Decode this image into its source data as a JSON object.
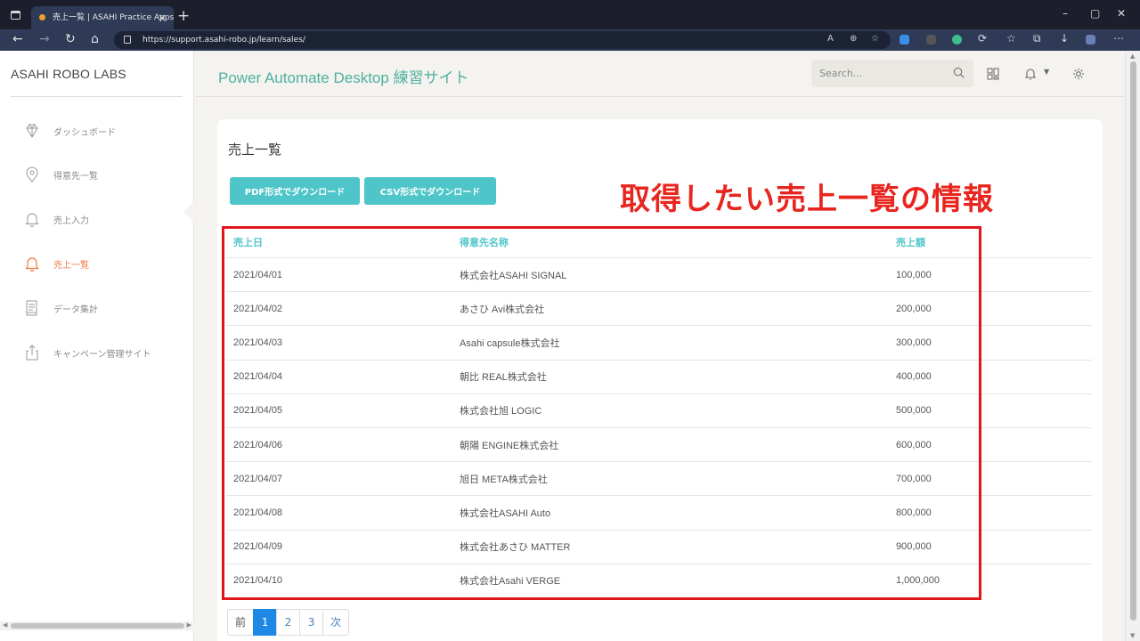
{
  "browser": {
    "tab_title": "売上一覧 | ASAHI Practice Apps",
    "tab_close": "×",
    "new_tab": "+",
    "url": "https://support.asahi-robo.jp/learn/sales/",
    "window_controls": [
      "–",
      "▢",
      "✕"
    ]
  },
  "sidebar": {
    "brand": "ASAHI ROBO LABS",
    "items": [
      {
        "label": "ダッシュボード",
        "icon": "diamond-icon",
        "active": false
      },
      {
        "label": "得意先一覧",
        "icon": "location-pin-icon",
        "active": false
      },
      {
        "label": "売上入力",
        "icon": "bell-icon",
        "active": false
      },
      {
        "label": "売上一覧",
        "icon": "bell-icon",
        "active": true
      },
      {
        "label": "データ集計",
        "icon": "document-icon",
        "active": false
      },
      {
        "label": "キャンペーン管理サイト",
        "icon": "share-icon",
        "active": false
      }
    ]
  },
  "header": {
    "title": "Power Automate Desktop 練習サイト",
    "search_placeholder": "Search..."
  },
  "main": {
    "page_title": "売上一覧",
    "pdf_button": "PDF形式でダウンロード",
    "csv_button": "CSV形式でダウンロード",
    "annotation": "取得したい売上一覧の情報",
    "table": {
      "columns": [
        "売上日",
        "得意先名称",
        "売上額"
      ],
      "rows": [
        [
          "2021/04/01",
          "株式会社ASAHI SIGNAL",
          "100,000"
        ],
        [
          "2021/04/02",
          "あさひ Avi株式会社",
          "200,000"
        ],
        [
          "2021/04/03",
          "Asahi capsule株式会社",
          "300,000"
        ],
        [
          "2021/04/04",
          "朝比 REAL株式会社",
          "400,000"
        ],
        [
          "2021/04/05",
          "株式会社旭 LOGIC",
          "500,000"
        ],
        [
          "2021/04/06",
          "朝陽 ENGINE株式会社",
          "600,000"
        ],
        [
          "2021/04/07",
          "旭日 META株式会社",
          "700,000"
        ],
        [
          "2021/04/08",
          "株式会社ASAHI Auto",
          "800,000"
        ],
        [
          "2021/04/09",
          "株式会社あさひ MATTER",
          "900,000"
        ],
        [
          "2021/04/10",
          "株式会社Asahi VERGE",
          "1,000,000"
        ]
      ]
    },
    "pagination": {
      "prev": "前",
      "pages": [
        "1",
        "2",
        "3"
      ],
      "current": "1",
      "next": "次"
    }
  },
  "colors": {
    "accent": "#4ec5c9",
    "title": "#4fb0a0",
    "active_nav": "#ee7a48",
    "annotation": "#e8261f",
    "page_active": "#1e88e5"
  }
}
